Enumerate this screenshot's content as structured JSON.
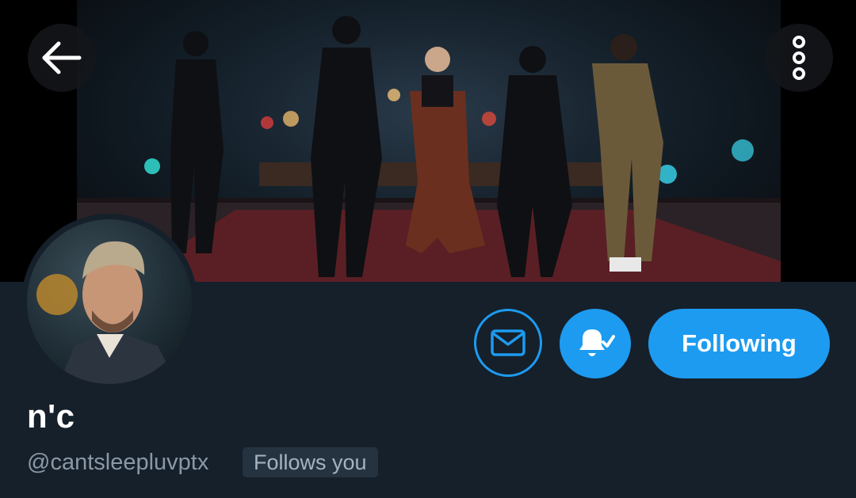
{
  "profile": {
    "display_name": "n'c",
    "handle": "@cantsleepluvptx",
    "follows_you_label": "Follows you"
  },
  "actions": {
    "following_label": "Following"
  },
  "icons": {
    "back": "arrow-left-icon",
    "more": "more-vertical-icon",
    "message": "envelope-icon",
    "notifications": "bell-check-icon"
  },
  "colors": {
    "background": "#15202b",
    "accent": "#1d9bf0",
    "secondary_text": "#8b98a5",
    "badge_bg": "#253341"
  }
}
